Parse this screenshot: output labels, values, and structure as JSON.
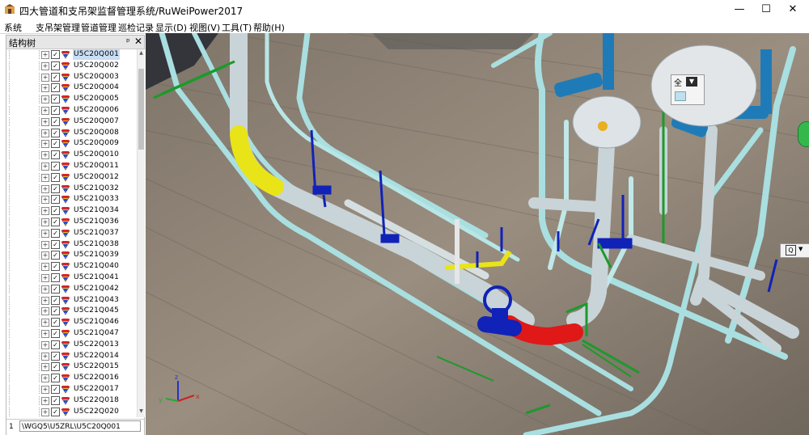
{
  "window": {
    "title": "四大管道和支吊架监督管理系统/RuWeiPower2017",
    "minimize_symbol": "—",
    "maximize_symbol": "☐",
    "close_symbol": "✕"
  },
  "menu": [
    "系统",
    "支吊架管理",
    "管道管理",
    "巡检记录",
    "显示(D)",
    "视图(V)",
    "工具(T)",
    "帮助(H)"
  ],
  "panel": {
    "title": "结构树",
    "pin_symbol": "ᵖ",
    "close_symbol": "✕",
    "expander_symbol": "+",
    "check_symbol": "✓",
    "items": [
      "U5C20Q001",
      "U5C20Q002",
      "U5C20Q003",
      "U5C20Q004",
      "U5C20Q005",
      "U5C20Q006",
      "U5C20Q007",
      "U5C20Q008",
      "U5C20Q009",
      "U5C20Q010",
      "U5C20Q011",
      "U5C20Q012",
      "U5C21Q032",
      "U5C21Q033",
      "U5C21Q034",
      "U5C21Q036",
      "U5C21Q037",
      "U5C21Q038",
      "U5C21Q039",
      "U5C21Q040",
      "U5C21Q041",
      "U5C21Q042",
      "U5C21Q043",
      "U5C21Q045",
      "U5C21Q046",
      "U5C21Q047",
      "U5C22Q013",
      "U5C22Q014",
      "U5C22Q015",
      "U5C22Q016",
      "U5C22Q017",
      "U5C22Q018",
      "U5C22Q020"
    ],
    "selected_index": 0
  },
  "status": {
    "index": "1",
    "path": "\\WGQ5\\U5ZRL\\U5C20Q001"
  },
  "viewport": {
    "dropdown_value": "全",
    "dropdown_arrow": "▼",
    "zoom_symbol": "Q",
    "zoom_arrow": "▼",
    "axis_x": "x",
    "axis_y": "y",
    "axis_z": "z"
  },
  "colors": {
    "floor": "#8a7d6e",
    "pipe_main": "#c9d4d8",
    "pipe_cyan": "#a9dfe0",
    "support_blue": "#1022b8",
    "support_green": "#1b9a2a",
    "elbow_yellow": "#e8e418",
    "elbow_red": "#e01818",
    "steel_blue": "#1f7bb8",
    "selection": "#c9ddf4"
  }
}
